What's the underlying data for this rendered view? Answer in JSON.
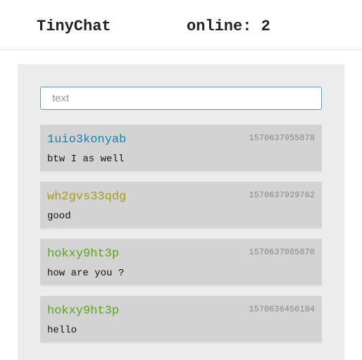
{
  "header": {
    "title": "TinyChat",
    "online_text": "online: 2"
  },
  "input": {
    "placeholder": "text",
    "value": ""
  },
  "messages": [
    {
      "user": "1uio3konyab",
      "user_color": "#1f82a8",
      "timestamp": "1570637955878",
      "text": "btw I as well"
    },
    {
      "user": "wh2gvs33qdg",
      "user_color": "#a89a1c",
      "timestamp": "1570637929762",
      "text": "good"
    },
    {
      "user": "hokxy9ht3p",
      "user_color": "#5aa51e",
      "timestamp": "1570637085870",
      "text": "how are you ?"
    },
    {
      "user": "hokxy9ht3p",
      "user_color": "#5aa51e",
      "timestamp": "1570636456184",
      "text": "hello"
    }
  ]
}
